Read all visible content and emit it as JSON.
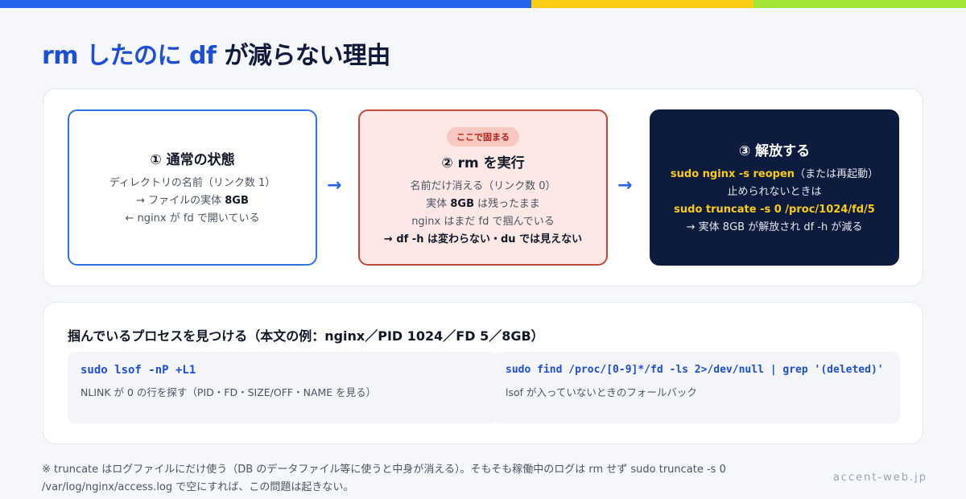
{
  "title": {
    "part1": "rm したのに df",
    "part2": "が減らない理由"
  },
  "flow": {
    "step1": {
      "title": "① 通常の状態",
      "lines": [
        "ディレクトリの名前（リンク数 1）",
        "→ ファイルの実体 ",
        "8GB",
        "← nginx が fd で開いている"
      ]
    },
    "step2": {
      "badge": "ここで固まる",
      "title": "② rm を実行",
      "line1": "名前だけ消える（リンク数 0）",
      "line2_pre": "実体 ",
      "line2_bold": "8GB",
      "line2_post": " は残ったまま",
      "line3": "nginx はまだ fd で掴んでいる",
      "line4": "→ df -h は変わらない・du では見えない"
    },
    "step3": {
      "title": "③ 解放する",
      "cmd1": "sudo nginx -s reopen",
      "cmd1_note": "（または再起動）",
      "line2": "止められないときは",
      "cmd2": "sudo truncate -s 0 /proc/1024/fd/5",
      "line4": "→ 実体 8GB が解放され df -h が減る"
    },
    "arrow": "→"
  },
  "process": {
    "heading": "掴んでいるプロセスを見つける（本文の例：nginx／PID 1024／FD 5／8GB）",
    "cmd1": "sudo lsof -nP +L1",
    "cmd1_desc": "NLINK が 0 の行を探す（PID・FD・SIZE/OFF・NAME を見る）",
    "cmd2": "sudo find /proc/[0-9]*/fd -ls 2>/dev/null | grep '(deleted)'",
    "cmd2_desc": "lsof が入っていないときのフォールバック"
  },
  "footnote": "※ truncate はログファイルにだけ使う（DB のデータファイル等に使うと中身が消える）。そもそも稼働中のログは rm せず sudo truncate -s 0 /var/log/nginx/access.log で空にすれば、この問題は起きない。",
  "site": "accent-web.jp",
  "colors": {
    "accent": "#2563eb",
    "danger": "#c4483a",
    "navy": "#0d1b3e",
    "highlight": "#facc15"
  }
}
